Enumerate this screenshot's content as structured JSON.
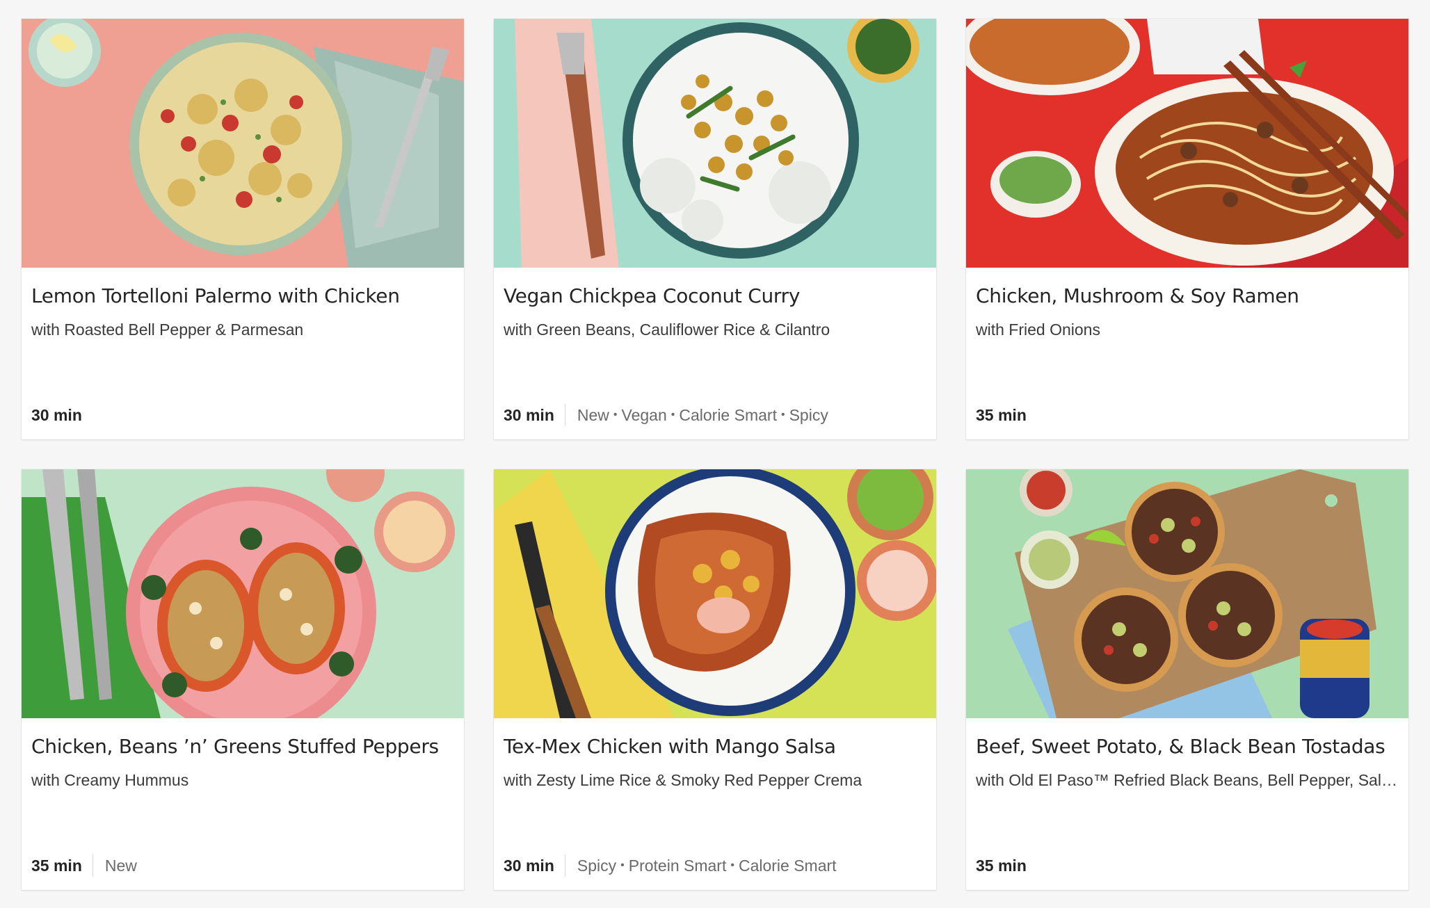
{
  "recipes": [
    {
      "title": "Lemon Tortelloni Palermo with Chicken",
      "subtitle": "with Roasted Bell Pepper & Parmesan",
      "time": "30 min",
      "tags": [],
      "image_icon": "pasta-bowl-photo"
    },
    {
      "title": "Vegan Chickpea Coconut Curry",
      "subtitle": "with Green Beans, Cauliflower Rice & Cilantro",
      "time": "30 min",
      "tags": [
        "New",
        "Vegan",
        "Calorie Smart",
        "Spicy"
      ],
      "image_icon": "curry-bowl-photo"
    },
    {
      "title": "Chicken, Mushroom & Soy Ramen",
      "subtitle": "with Fried Onions",
      "time": "35 min",
      "tags": [],
      "image_icon": "ramen-bowl-photo"
    },
    {
      "title": "Chicken, Beans ’n’ Greens Stuffed Peppers",
      "subtitle": "with Creamy Hummus",
      "time": "35 min",
      "tags": [
        "New"
      ],
      "image_icon": "stuffed-peppers-photo"
    },
    {
      "title": "Tex-Mex Chicken with Mango Salsa",
      "subtitle": "with Zesty Lime Rice & Smoky Red Pepper Crema",
      "time": "30 min",
      "tags": [
        "Spicy",
        "Protein Smart",
        "Calorie Smart"
      ],
      "image_icon": "chicken-rice-bowl-photo"
    },
    {
      "title": "Beef, Sweet Potato, & Black Bean Tostadas",
      "subtitle": "with Old El Paso™ Refried Black Beans, Bell Pepper, Salsa & Avocado Crema",
      "time": "35 min",
      "tags": [],
      "image_icon": "tostadas-board-photo"
    }
  ],
  "colors": {
    "page_bg": "#f6f6f6",
    "card_bg": "#ffffff",
    "title": "#242424",
    "tag_text": "#6a6a6a"
  }
}
